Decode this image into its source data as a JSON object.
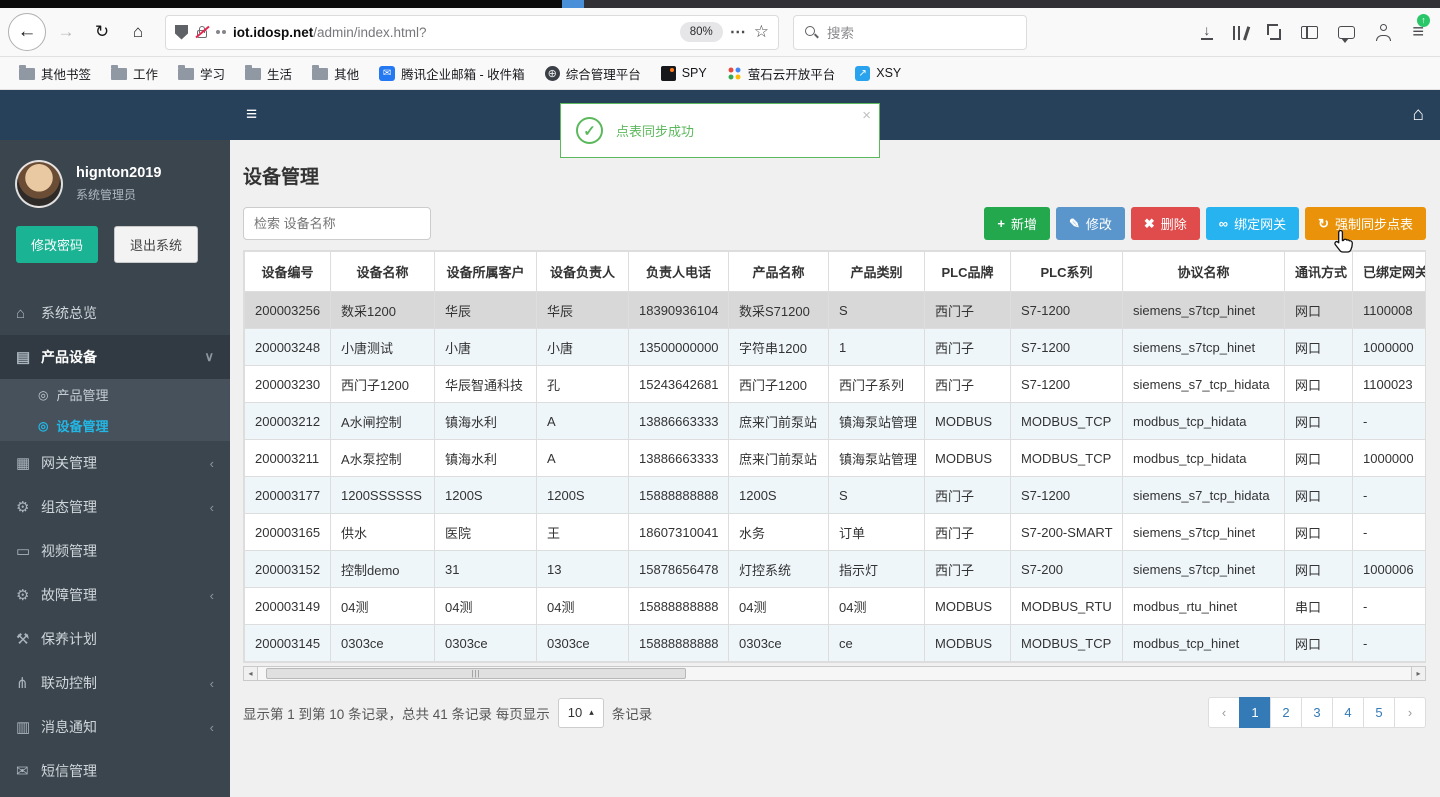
{
  "colors": {
    "app_navbar": "#28415b",
    "sidebar": "#3b454e",
    "accent_blue": "#337ab7",
    "active_menu_blue": "#23b7e5",
    "toast_green": "#5cb85c",
    "primary_green": "#1ab394"
  },
  "browser": {
    "url_domain": "iot.idosp.net",
    "url_path": "/admin/index.html?",
    "zoom": "80%",
    "search_placeholder": "搜索",
    "bookmarks": [
      {
        "icon": "folder",
        "label": "其他书签"
      },
      {
        "icon": "folder",
        "label": "工作"
      },
      {
        "icon": "folder",
        "label": "学习"
      },
      {
        "icon": "folder",
        "label": "生活"
      },
      {
        "icon": "folder",
        "label": "其他"
      },
      {
        "icon": "mail",
        "label": "腾讯企业邮箱 - 收件箱"
      },
      {
        "icon": "globe",
        "label": "综合管理平台"
      },
      {
        "icon": "spy",
        "label": "SPY"
      },
      {
        "icon": "dots",
        "label": "萤石云开放平台"
      },
      {
        "icon": "xsy",
        "label": "XSY"
      }
    ]
  },
  "toast": {
    "message": "点表同步成功",
    "close_label": "×"
  },
  "sidebar": {
    "username": "hignton2019",
    "role": "系统管理员",
    "change_password": "修改密码",
    "logout": "退出系统",
    "menu": [
      {
        "icon": "home",
        "label": "系统总览",
        "chevron": "",
        "active": false
      },
      {
        "icon": "book",
        "label": "产品设备",
        "chevron": "down",
        "active": true,
        "submenu": [
          {
            "label": "产品管理",
            "active": false
          },
          {
            "label": "设备管理",
            "active": true
          }
        ]
      },
      {
        "icon": "grid",
        "label": "网关管理",
        "chevron": "left",
        "active": false
      },
      {
        "icon": "gears",
        "label": "组态管理",
        "chevron": "left",
        "active": false
      },
      {
        "icon": "monitor",
        "label": "视频管理",
        "chevron": "",
        "active": false
      },
      {
        "icon": "gears",
        "label": "故障管理",
        "chevron": "left",
        "active": false
      },
      {
        "icon": "wrench",
        "label": "保养计划",
        "chevron": "",
        "active": false
      },
      {
        "icon": "sitemap",
        "label": "联动控制",
        "chevron": "left",
        "active": false
      },
      {
        "icon": "layers",
        "label": "消息通知",
        "chevron": "left",
        "active": false
      },
      {
        "icon": "envelope",
        "label": "短信管理",
        "chevron": "",
        "active": false
      }
    ]
  },
  "main": {
    "title": "设备管理",
    "search_placeholder": "检索 设备名称",
    "buttons": [
      {
        "label": "新增",
        "icon": "plus",
        "color": "#23a84e",
        "name": "add-button"
      },
      {
        "label": "修改",
        "icon": "pencil",
        "color": "#5a96cc",
        "name": "edit-button"
      },
      {
        "label": "删除",
        "icon": "cross",
        "color": "#e04b4b",
        "name": "delete-button"
      },
      {
        "label": "绑定网关",
        "icon": "link",
        "color": "#27b3ef",
        "name": "bind-gateway-button"
      },
      {
        "label": "强制同步点表",
        "icon": "refresh",
        "color": "#ea930a",
        "name": "force-sync-button"
      }
    ],
    "table": {
      "headers": [
        "设备编号",
        "设备名称",
        "设备所属客户",
        "设备负责人",
        "负责人电话",
        "产品名称",
        "产品类别",
        "PLC品牌",
        "PLC系列",
        "协议名称",
        "通讯方式",
        "已绑定网关"
      ],
      "selected_row": 0,
      "rows": [
        [
          "200003256",
          "数采1200",
          "华辰",
          "华辰",
          "18390936104",
          "数采S71200",
          "S",
          "西门子",
          "S7-1200",
          "siemens_s7tcp_hinet",
          "网口",
          "1100008"
        ],
        [
          "200003248",
          "小唐测试",
          "小唐",
          "小唐",
          "13500000000",
          "字符串1200",
          "1",
          "西门子",
          "S7-1200",
          "siemens_s7tcp_hinet",
          "网口",
          "1000000"
        ],
        [
          "200003230",
          "西门子1200",
          "华辰智通科技",
          "孔",
          "15243642681",
          "西门子1200",
          "西门子系列",
          "西门子",
          "S7-1200",
          "siemens_s7_tcp_hidata",
          "网口",
          "1100023"
        ],
        [
          "200003212",
          "A水闸控制",
          "镇海水利",
          "A",
          "13886663333",
          "庶来门前泵站",
          "镇海泵站管理",
          "MODBUS",
          "MODBUS_TCP",
          "modbus_tcp_hidata",
          "网口",
          "-"
        ],
        [
          "200003211",
          "A水泵控制",
          "镇海水利",
          "A",
          "13886663333",
          "庶来门前泵站",
          "镇海泵站管理",
          "MODBUS",
          "MODBUS_TCP",
          "modbus_tcp_hidata",
          "网口",
          "1000000"
        ],
        [
          "200003177",
          "1200SSSSSS",
          "1200S",
          "1200S",
          "15888888888",
          "1200S",
          "S",
          "西门子",
          "S7-1200",
          "siemens_s7_tcp_hidata",
          "网口",
          "-"
        ],
        [
          "200003165",
          "供水",
          "医院",
          "王",
          "18607310041",
          "水务",
          "订单",
          "西门子",
          "S7-200-SMART",
          "siemens_s7tcp_hinet",
          "网口",
          "-"
        ],
        [
          "200003152",
          "控制demo",
          "31",
          "13",
          "15878656478",
          "灯控系统",
          "指示灯",
          "西门子",
          "S7-200",
          "siemens_s7tcp_hinet",
          "网口",
          "1000006"
        ],
        [
          "200003149",
          "04测",
          "04测",
          "04测",
          "15888888888",
          "04测",
          "04测",
          "MODBUS",
          "MODBUS_RTU",
          "modbus_rtu_hinet",
          "串口",
          "-"
        ],
        [
          "200003145",
          "0303ce",
          "0303ce",
          "0303ce",
          "15888888888",
          "0303ce",
          "ce",
          "MODBUS",
          "MODBUS_TCP",
          "modbus_tcp_hinet",
          "网口",
          "-"
        ]
      ]
    },
    "pagination": {
      "info_prefix": "显示第 1 到第 10 条记录，总共 41 条记录 每页显示",
      "page_size": "10",
      "info_suffix": "条记录",
      "pages": [
        "‹",
        "1",
        "2",
        "3",
        "4",
        "5",
        "›"
      ],
      "active_page": "1"
    }
  }
}
